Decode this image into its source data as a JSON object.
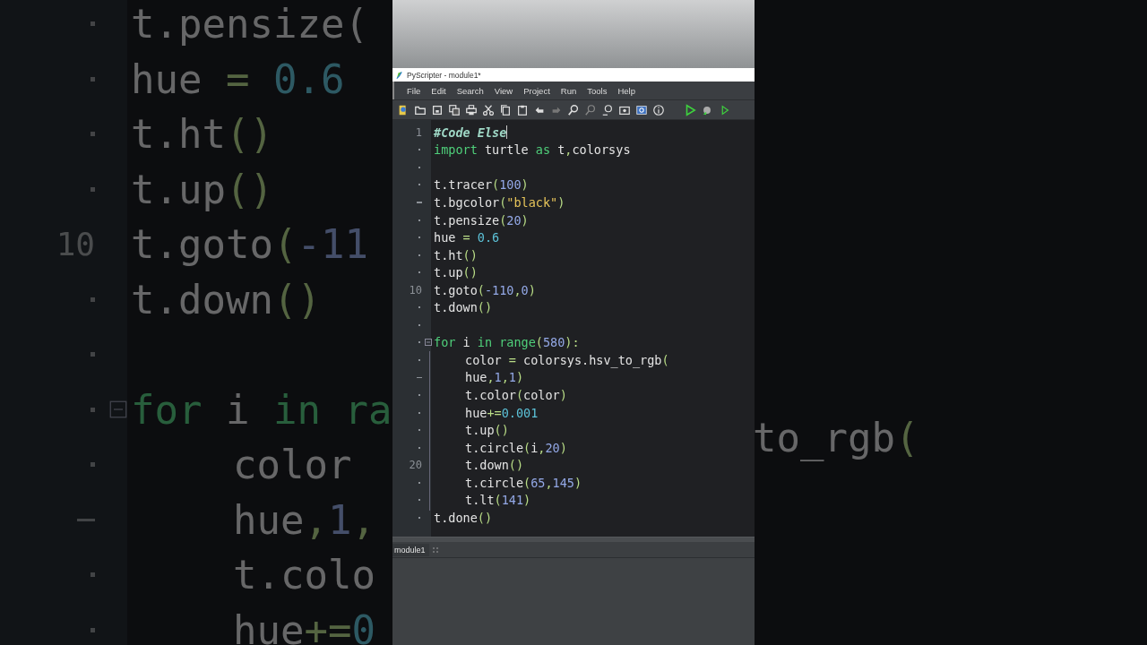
{
  "backdrop_left": {
    "lines": [
      {
        "kind": "dot",
        "tokens": [
          {
            "text": "t.pensize(",
            "kind": "name"
          }
        ]
      },
      {
        "kind": "dot",
        "tokens": [
          {
            "text": "hue ",
            "kind": "name"
          },
          {
            "text": "=",
            "kind": "op"
          },
          {
            "text": " 0.6",
            "kind": "float"
          }
        ]
      },
      {
        "kind": "dot",
        "tokens": [
          {
            "text": "t.ht",
            "kind": "name"
          },
          {
            "text": "()",
            "kind": "paren"
          }
        ]
      },
      {
        "kind": "dot",
        "tokens": [
          {
            "text": "t.up",
            "kind": "name"
          },
          {
            "text": "()",
            "kind": "paren"
          }
        ]
      },
      {
        "kind": "number",
        "number": "10",
        "tokens": [
          {
            "text": "t.goto",
            "kind": "name"
          },
          {
            "text": "(",
            "kind": "paren"
          },
          {
            "text": "-11",
            "kind": "num"
          }
        ]
      },
      {
        "kind": "dot",
        "tokens": [
          {
            "text": "t.down",
            "kind": "name"
          },
          {
            "text": "()",
            "kind": "paren"
          }
        ]
      },
      {
        "kind": "dot"
      },
      {
        "kind": "dot",
        "fold": true,
        "tokens": [
          {
            "text": "for",
            "kind": "kw"
          },
          {
            "text": " i ",
            "kind": "name"
          },
          {
            "text": "in",
            "kind": "kw"
          },
          {
            "text": " ra",
            "kind": "kw"
          }
        ]
      },
      {
        "kind": "dot",
        "indent": true,
        "tokens": [
          {
            "text": "color",
            "kind": "name"
          }
        ]
      },
      {
        "kind": "dash",
        "indent": true,
        "tokens": [
          {
            "text": "hue",
            "kind": "name"
          },
          {
            "text": ",",
            "kind": "paren"
          },
          {
            "text": "1",
            "kind": "num"
          },
          {
            "text": ",",
            "kind": "paren"
          }
        ]
      },
      {
        "kind": "dot",
        "indent": true,
        "tokens": [
          {
            "text": "t.colo",
            "kind": "name"
          }
        ]
      },
      {
        "kind": "dot",
        "indent": true,
        "tokens": [
          {
            "text": "hue",
            "kind": "name"
          },
          {
            "text": "+=",
            "kind": "op"
          },
          {
            "text": "0",
            "kind": "float"
          }
        ]
      }
    ]
  },
  "window": {
    "title": "PyScripter - module1*"
  },
  "menu": [
    "File",
    "Edit",
    "Search",
    "View",
    "Project",
    "Run",
    "Tools",
    "Help"
  ],
  "editor": {
    "lines": [
      {
        "kind": "number",
        "number": "1",
        "tokens": [
          {
            "text": "#Code Else",
            "kind": "comment"
          }
        ]
      },
      {
        "kind": "dot",
        "tokens": [
          {
            "text": "import",
            "kind": "kw"
          },
          {
            "text": " turtle ",
            "kind": "name"
          },
          {
            "text": "as",
            "kind": "kw"
          },
          {
            "text": " t",
            "kind": "name"
          },
          {
            "text": ",",
            "kind": "paren"
          },
          {
            "text": "colorsys",
            "kind": "name"
          }
        ]
      },
      {
        "kind": "dot"
      },
      {
        "kind": "dot",
        "tokens": [
          {
            "text": "t.tracer",
            "kind": "name"
          },
          {
            "text": "(",
            "kind": "paren"
          },
          {
            "text": "100",
            "kind": "num"
          },
          {
            "text": ")",
            "kind": "paren"
          }
        ]
      },
      {
        "kind": "dash",
        "tokens": [
          {
            "text": "t.bgcolor",
            "kind": "name"
          },
          {
            "text": "(",
            "kind": "paren"
          },
          {
            "text": "\"black\"",
            "kind": "str"
          },
          {
            "text": ")",
            "kind": "paren"
          }
        ]
      },
      {
        "kind": "dot",
        "tokens": [
          {
            "text": "t.pensize",
            "kind": "name"
          },
          {
            "text": "(",
            "kind": "paren"
          },
          {
            "text": "20",
            "kind": "num"
          },
          {
            "text": ")",
            "kind": "paren"
          }
        ]
      },
      {
        "kind": "dot",
        "tokens": [
          {
            "text": "hue ",
            "kind": "name"
          },
          {
            "text": "=",
            "kind": "op"
          },
          {
            "text": " 0.6",
            "kind": "float"
          }
        ]
      },
      {
        "kind": "dot",
        "tokens": [
          {
            "text": "t.ht",
            "kind": "name"
          },
          {
            "text": "()",
            "kind": "paren"
          }
        ]
      },
      {
        "kind": "dot",
        "tokens": [
          {
            "text": "t.up",
            "kind": "name"
          },
          {
            "text": "()",
            "kind": "paren"
          }
        ]
      },
      {
        "kind": "number",
        "number": "10",
        "tokens": [
          {
            "text": "t.goto",
            "kind": "name"
          },
          {
            "text": "(",
            "kind": "paren"
          },
          {
            "text": "-110",
            "kind": "num"
          },
          {
            "text": ",",
            "kind": "paren"
          },
          {
            "text": "0",
            "kind": "num"
          },
          {
            "text": ")",
            "kind": "paren"
          }
        ]
      },
      {
        "kind": "dot",
        "tokens": [
          {
            "text": "t.down",
            "kind": "name"
          },
          {
            "text": "()",
            "kind": "paren"
          }
        ]
      },
      {
        "kind": "dot"
      },
      {
        "kind": "dot",
        "fold": true,
        "tokens": [
          {
            "text": "for",
            "kind": "kw"
          },
          {
            "text": " i ",
            "kind": "name"
          },
          {
            "text": "in",
            "kind": "kw"
          },
          {
            "text": " range",
            "kind": "kw"
          },
          {
            "text": "(",
            "kind": "paren"
          },
          {
            "text": "580",
            "kind": "num"
          },
          {
            "text": "):",
            "kind": "paren"
          }
        ]
      },
      {
        "kind": "dot",
        "indent": true,
        "tokens": [
          {
            "text": "color ",
            "kind": "name"
          },
          {
            "text": "=",
            "kind": "op"
          },
          {
            "text": " colorsys.hsv_to_rgb",
            "kind": "name"
          },
          {
            "text": "(",
            "kind": "paren"
          }
        ]
      },
      {
        "kind": "dash",
        "indent": true,
        "tokens": [
          {
            "text": "hue",
            "kind": "name"
          },
          {
            "text": ",",
            "kind": "paren"
          },
          {
            "text": "1",
            "kind": "num"
          },
          {
            "text": ",",
            "kind": "paren"
          },
          {
            "text": "1",
            "kind": "num"
          },
          {
            "text": ")",
            "kind": "paren"
          }
        ]
      },
      {
        "kind": "dot",
        "indent": true,
        "tokens": [
          {
            "text": "t.color",
            "kind": "name"
          },
          {
            "text": "(",
            "kind": "paren"
          },
          {
            "text": "color",
            "kind": "name"
          },
          {
            "text": ")",
            "kind": "paren"
          }
        ]
      },
      {
        "kind": "dot",
        "indent": true,
        "tokens": [
          {
            "text": "hue",
            "kind": "name"
          },
          {
            "text": "+=",
            "kind": "op"
          },
          {
            "text": "0.001",
            "kind": "float"
          }
        ]
      },
      {
        "kind": "dot",
        "indent": true,
        "tokens": [
          {
            "text": "t.up",
            "kind": "name"
          },
          {
            "text": "()",
            "kind": "paren"
          }
        ]
      },
      {
        "kind": "dot",
        "indent": true,
        "tokens": [
          {
            "text": "t.circle",
            "kind": "name"
          },
          {
            "text": "(",
            "kind": "paren"
          },
          {
            "text": "i",
            "kind": "name"
          },
          {
            "text": ",",
            "kind": "paren"
          },
          {
            "text": "20",
            "kind": "num"
          },
          {
            "text": ")",
            "kind": "paren"
          }
        ]
      },
      {
        "kind": "number",
        "number": "20",
        "indent": true,
        "tokens": [
          {
            "text": "t.down",
            "kind": "name"
          },
          {
            "text": "()",
            "kind": "paren"
          }
        ]
      },
      {
        "kind": "dot",
        "indent": true,
        "tokens": [
          {
            "text": "t.circle",
            "kind": "name"
          },
          {
            "text": "(",
            "kind": "paren"
          },
          {
            "text": "65",
            "kind": "num"
          },
          {
            "text": ",",
            "kind": "paren"
          },
          {
            "text": "145",
            "kind": "num"
          },
          {
            "text": ")",
            "kind": "paren"
          }
        ]
      },
      {
        "kind": "dot",
        "indent": true,
        "tokens": [
          {
            "text": "t.lt",
            "kind": "name"
          },
          {
            "text": "(",
            "kind": "paren"
          },
          {
            "text": "141",
            "kind": "num"
          },
          {
            "text": ")",
            "kind": "paren"
          }
        ]
      },
      {
        "kind": "dot",
        "tokens": [
          {
            "text": "t.done",
            "kind": "name"
          },
          {
            "text": "()",
            "kind": "paren"
          }
        ]
      }
    ]
  },
  "tabs": [
    {
      "label": "module1",
      "selected": true
    }
  ],
  "backdrop_right": {
    "lines": [
      {
        "tokens": [
          {
            "text": "to_rgb",
            "kind": "name"
          },
          {
            "text": "(",
            "kind": "paren"
          }
        ]
      }
    ]
  }
}
